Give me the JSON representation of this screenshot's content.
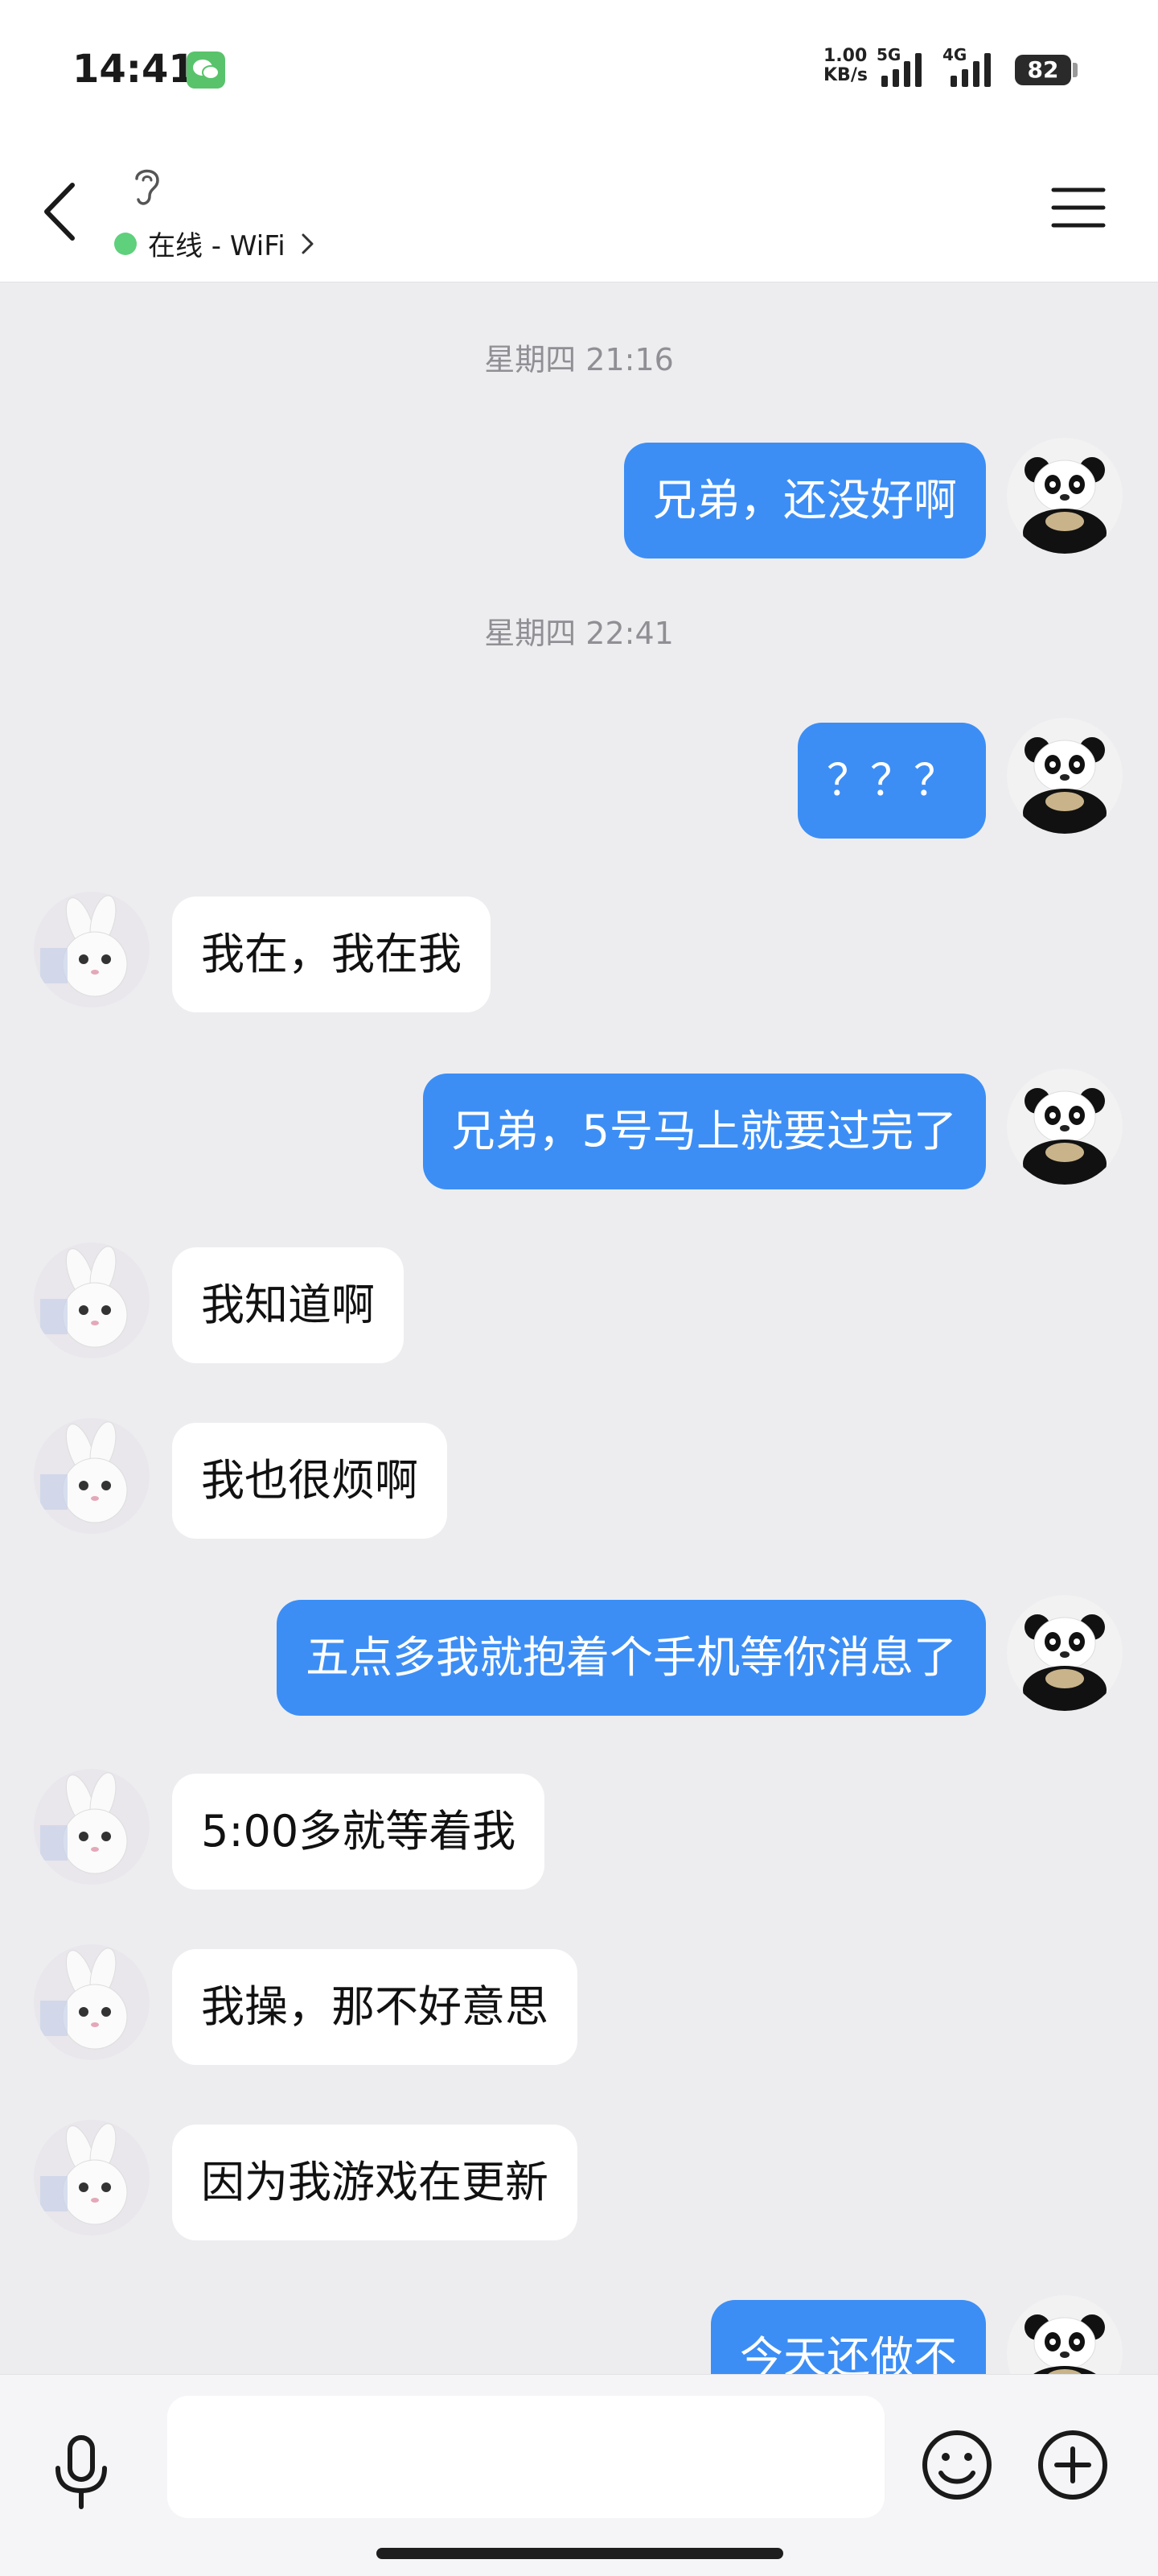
{
  "status_bar": {
    "time": "14:41",
    "net_speed_value": "1.00",
    "net_speed_unit": "KB/s",
    "network_1": "5G",
    "network_2": "4G",
    "battery": "82"
  },
  "header": {
    "connection_status": "在线 - WiFi",
    "online_color": "#5fd07c"
  },
  "chat": {
    "messages": [
      {
        "type": "time",
        "text": "星期四 21:16"
      },
      {
        "type": "sent",
        "text": "兄弟，还没好啊"
      },
      {
        "type": "time",
        "text": "星期四 22:41"
      },
      {
        "type": "sent",
        "text": "？？？"
      },
      {
        "type": "received",
        "text": "我在，我在我"
      },
      {
        "type": "sent",
        "text": "兄弟，5号马上就要过完了"
      },
      {
        "type": "received",
        "text": "我知道啊"
      },
      {
        "type": "received",
        "text": "我也很烦啊"
      },
      {
        "type": "sent",
        "text": "五点多我就抱着个手机等你消息了"
      },
      {
        "type": "received",
        "text": "5:00多就等着我"
      },
      {
        "type": "received",
        "text": "我操，那不好意思"
      },
      {
        "type": "received",
        "text": "因为我游戏在更新"
      },
      {
        "type": "sent",
        "text": "今天还做不"
      }
    ],
    "sent_bubble_color": "#3c8ef5",
    "received_bubble_color": "#ffffff"
  },
  "input_bar": {
    "text_value": "",
    "icons": [
      "microphone-icon",
      "emoji-icon",
      "plus-icon"
    ]
  }
}
